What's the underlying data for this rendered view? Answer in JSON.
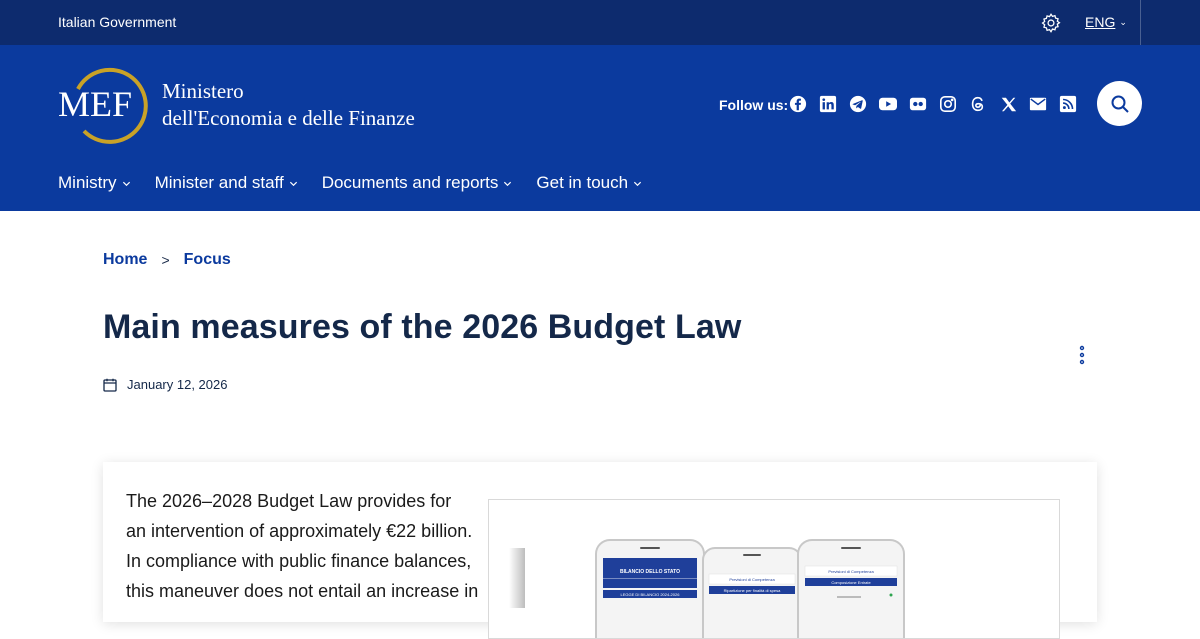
{
  "topbar": {
    "government_label": "Italian Government",
    "language": "ENG"
  },
  "header": {
    "logo_text": "MEF",
    "ministry_line1": "Ministero",
    "ministry_line2": "dell'Economia e delle Finanze",
    "follow_label": "Follow us:",
    "social_icons": [
      "facebook-icon",
      "linkedin-icon",
      "telegram-icon",
      "youtube-icon",
      "flickr-icon",
      "instagram-icon",
      "threads-icon",
      "x-icon",
      "email-icon",
      "rss-icon"
    ]
  },
  "nav": {
    "items": [
      {
        "label": "Ministry"
      },
      {
        "label": "Minister and staff"
      },
      {
        "label": "Documents and reports"
      },
      {
        "label": "Get in touch"
      }
    ]
  },
  "breadcrumb": {
    "home": "Home",
    "separator": ">",
    "current": "Focus"
  },
  "article": {
    "title": "Main measures of the 2026 Budget Law",
    "date": "January 12, 2026",
    "intro_lines": [
      "The 2026–2028 Budget Law provides for",
      "an intervention of approximately €22 billion.",
      "In compliance with public finance balances,",
      "this maneuver does not entail an increase in"
    ]
  },
  "image": {
    "phone1_header": "BILANCIO DELLO STATO",
    "phone1_band": "LEGGE DI BILANCIO 2024-2026",
    "phone2_header": "Previsioni di Competenza",
    "phone2_band": "Ripartizione per finalità di spesa",
    "phone3_header": "Previsioni di Competenza",
    "phone3_band": "Composizione Entrate"
  },
  "colors": {
    "topbar": "#0d2b6e",
    "header": "#0b3a9e",
    "title": "#142849",
    "accent_gold": "#c9a227"
  }
}
